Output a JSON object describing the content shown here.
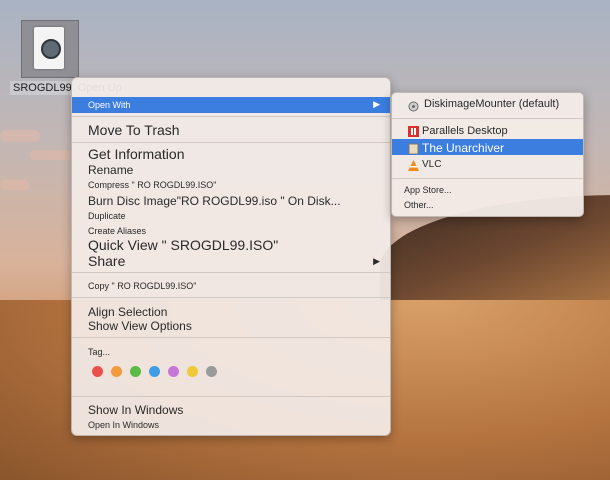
{
  "desktop": {
    "file_label": "SROGDL99. Open Up"
  },
  "context_menu": {
    "open_with": "Open With",
    "move_to_trash": "Move To Trash",
    "get_information": "Get Information",
    "rename": "Rename",
    "compress": "Compress \" RO ROGDL99.ISO\"",
    "burn": "Burn Disc Image\"RO ROGDL99.iso \" On Disk...",
    "duplicate": "Duplicate",
    "create_aliases": "Create Aliases",
    "quick_view": "Quick View \" SROGDL99.ISO\"",
    "share": "Share",
    "copy": "Copy \" RO ROGDL99.ISO\"",
    "align_selection": "Align Selection",
    "show_view_options": "Show View Options",
    "tags": "Tag...",
    "tag_colors": [
      "#e9524a",
      "#f39a3c",
      "#5cba47",
      "#3f9de6",
      "#c776d8",
      "#f0c93a",
      "#9a9a9a"
    ],
    "show_in_windows": "Show In Windows",
    "open_in_windows": "Open In Windows"
  },
  "open_with_submenu": {
    "items": [
      {
        "label": "DiskimageMounter (default)"
      },
      {
        "label": "Parallels Desktop"
      },
      {
        "label": "The Unarchiver"
      },
      {
        "label": "VLC"
      }
    ],
    "app_store": "App Store...",
    "other": "Other..."
  },
  "colors": {
    "highlight": "#3b7ee0"
  }
}
